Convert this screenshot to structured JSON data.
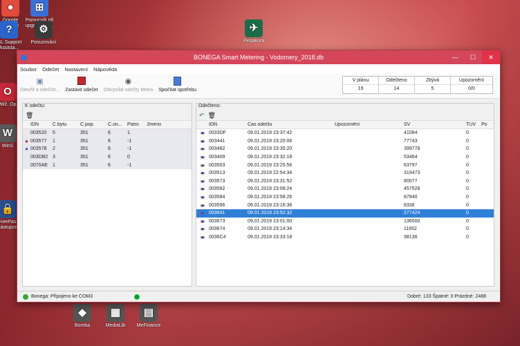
{
  "desktop": {
    "icons": [
      {
        "label": "Google Chrome",
        "glyph": "●",
        "color": "#e04b3c"
      },
      {
        "label": "Pomocník při upgradu na...",
        "glyph": "⊞",
        "color": "#3b6fd8"
      },
      {
        "label": "ISL Support Assista...",
        "glyph": "?",
        "color": "#2a64c9"
      },
      {
        "label": "Posuzování",
        "glyph": "⚙",
        "color": "#3a3a3a"
      },
      {
        "label": "Pepakura",
        "glyph": "✈",
        "color": "#1e6b4a"
      },
      {
        "label": "Prohlíž. Opera",
        "glyph": "O",
        "color": "#c8283a"
      },
      {
        "label": "WinS",
        "glyph": "W",
        "color": "#5a5a5a"
      },
      {
        "label": "KeePas zástupce",
        "glyph": "🔒",
        "color": "#2a4f8f"
      },
      {
        "label": "Bomba",
        "glyph": "◆",
        "color": "#555"
      },
      {
        "label": "MediaLib",
        "glyph": "▦",
        "color": "#555"
      },
      {
        "label": "MeFinance",
        "glyph": "▤",
        "color": "#555"
      }
    ]
  },
  "window": {
    "title": "BONEGA Smart Metering - Vodomery_2018.db",
    "controls": {
      "minimize": "—",
      "maximize": "☐",
      "close": "✕"
    }
  },
  "menu": [
    "Soubor",
    "Odečet",
    "Nastavení",
    "Nápověda"
  ],
  "toolbar": {
    "start": "Otevřít a odečíst...",
    "stop": "Zastavit odečet",
    "send": "Odvysílat odečty Metra",
    "calc": "Spočítat spotřebu",
    "colors": {
      "stop": "#c4252b",
      "calc": "#4a7bd0"
    }
  },
  "stats": [
    {
      "label": "V plánu",
      "value": "19"
    },
    {
      "label": "Odečteno",
      "value": "14"
    },
    {
      "label": "Zbývá",
      "value": "5"
    },
    {
      "label": "Upozornění",
      "value": "0/0"
    }
  ],
  "left_panel": {
    "title": "K odečtu:",
    "columns": [
      "IDN",
      "Č.bytu",
      "Č.pop.",
      "Č.ori...",
      "Patro",
      "Jméno"
    ],
    "rows": [
      {
        "drop": "",
        "idn": "003520",
        "byt": "5",
        "pop": "351",
        "ori": "6",
        "patro": "1",
        "jmeno": ""
      },
      {
        "drop": "red",
        "idn": "003577",
        "byt": "1",
        "pop": "351",
        "ori": "6",
        "patro": "-1",
        "jmeno": ""
      },
      {
        "drop": "blue",
        "idn": "003578",
        "byt": "2",
        "pop": "351",
        "ori": "6",
        "patro": "-1",
        "jmeno": ""
      },
      {
        "drop": "",
        "idn": "003DB2",
        "byt": "3",
        "pop": "351",
        "ori": "6",
        "patro": "0",
        "jmeno": ""
      },
      {
        "drop": "",
        "idn": "0070AE",
        "byt": "1",
        "pop": "351",
        "ori": "6",
        "patro": "-1",
        "jmeno": ""
      }
    ]
  },
  "right_panel": {
    "title": "Odečteno:",
    "columns": [
      "IDN",
      "Čas odečtu",
      "Upozornění",
      "SV",
      "TUV",
      "Po"
    ],
    "rows": [
      {
        "idn": "0033DF",
        "time": "09.01.2019 23:37:42",
        "sv": "41084",
        "tuv": "0"
      },
      {
        "idn": "003441",
        "time": "09.01.2019 23:20:06",
        "sv": "77743",
        "tuv": "0"
      },
      {
        "idn": "003482",
        "time": "09.01.2019 23:35:20",
        "sv": "399778",
        "tuv": "0"
      },
      {
        "idn": "003409",
        "time": "09.01.2019 23:32:18",
        "sv": "53464",
        "tuv": "0"
      },
      {
        "idn": "003503",
        "time": "09.01.2019 23:25:56",
        "sv": "63797",
        "tuv": "0"
      },
      {
        "idn": "003513",
        "time": "09.01.2019 22:54:34",
        "sv": "319473",
        "tuv": "0"
      },
      {
        "idn": "003573",
        "time": "09.01.2019 23:31:52",
        "sv": "80077",
        "tuv": "0"
      },
      {
        "idn": "003582",
        "time": "09.01.2019 23:08:24",
        "sv": "457528",
        "tuv": "0"
      },
      {
        "idn": "003584",
        "time": "09.01.2019 23:58:26",
        "sv": "87840",
        "tuv": "0"
      },
      {
        "idn": "003596",
        "time": "09.01.2019 23:16:36",
        "sv": "8336",
        "tuv": "0"
      },
      {
        "idn": "003641",
        "time": "09.01.2019 23:52:32",
        "sv": "277424",
        "tuv": "0"
      },
      {
        "idn": "003673",
        "time": "09.01.2019 23:01:00",
        "sv": "136500",
        "tuv": "0"
      },
      {
        "idn": "003674",
        "time": "09.01.2019 23:14:34",
        "sv": "11652",
        "tuv": "0"
      },
      {
        "idn": "0036C4",
        "time": "09.01.2019 23:33:18",
        "sv": "38136",
        "tuv": "0"
      }
    ],
    "selected_row": "003641"
  },
  "status": {
    "connection": "Bonega: Připojeno ke  COM3",
    "summary": "Dobré: 133 Špatné: 0 Prázdné: 2488",
    "colors": {
      "connected": "#3aa53a",
      "indicator": "#1f8a3d"
    }
  }
}
